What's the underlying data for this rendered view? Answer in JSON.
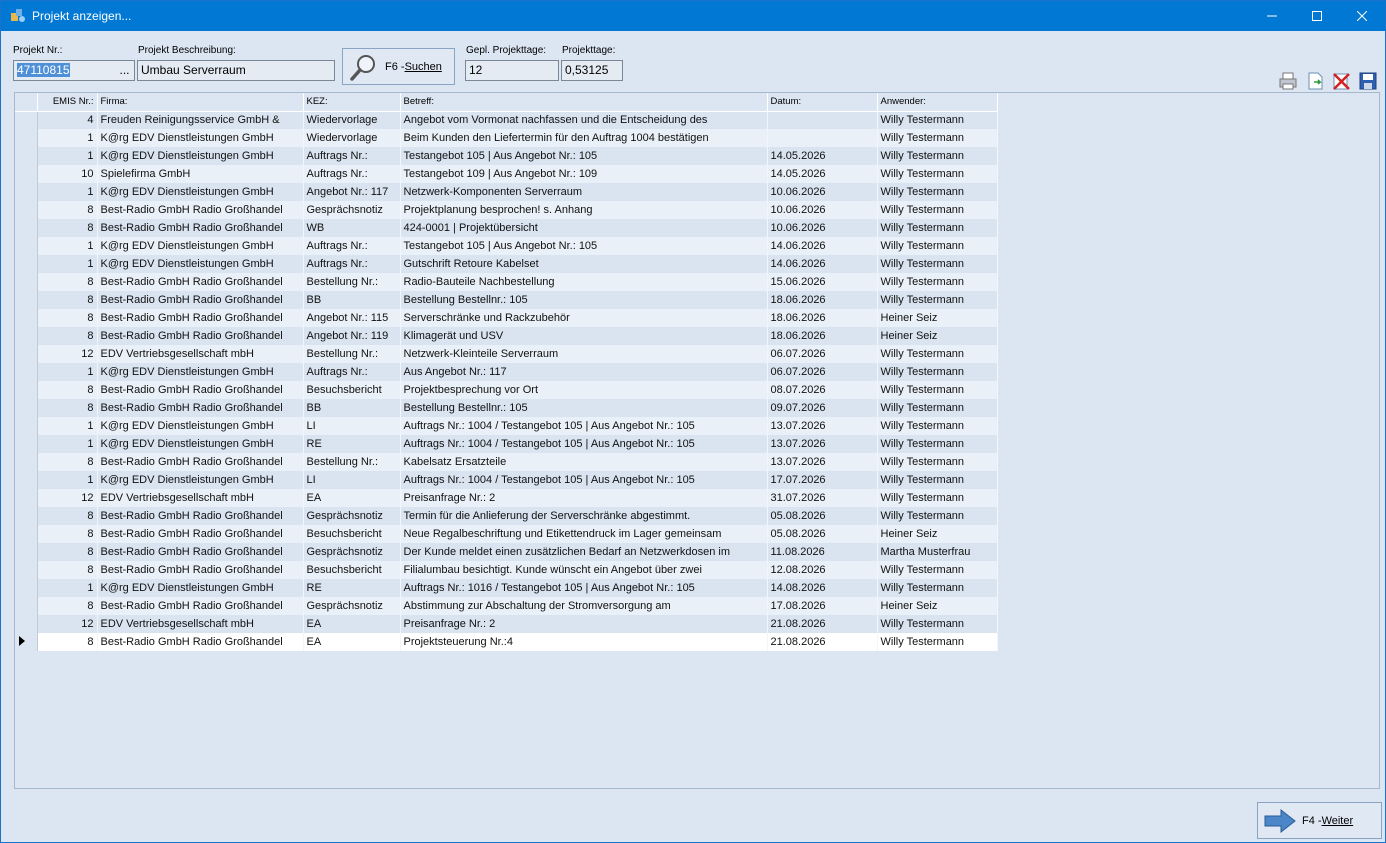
{
  "window": {
    "title": "Projekt anzeigen..."
  },
  "form": {
    "projekt_nr_label": "Projekt Nr.:",
    "projekt_nr_value": "47110815",
    "browse_label": "...",
    "beschreibung_label": "Projekt Beschreibung:",
    "beschreibung_value": "Umbau Serverraum",
    "search_button_key": "F6 - ",
    "search_button_label": "Suchen",
    "gepl_label": "Gepl. Projekttage:",
    "gepl_value": "12",
    "tage_label": "Projekttage:",
    "tage_value": "0,53125"
  },
  "toolbar": {
    "icons": [
      "print-icon",
      "export-icon",
      "delete-icon",
      "save-icon"
    ]
  },
  "table": {
    "columns": [
      "EMIS Nr.:",
      "Firma:",
      "KEZ:",
      "Betreff:",
      "Datum:",
      "Anwender:"
    ],
    "active_row_index": 29,
    "rows": [
      [
        "4",
        "Freuden Reinigungsservice GmbH &",
        "Wiedervorlage",
        "Angebot vom Vormonat nachfassen und die Entscheidung des",
        "",
        "Willy Testermann"
      ],
      [
        "1",
        "K@rg EDV Dienstleistungen GmbH",
        "Wiedervorlage",
        "Beim Kunden den Liefertermin für den Auftrag 1004 bestätigen",
        "",
        "Willy Testermann"
      ],
      [
        "1",
        "K@rg EDV Dienstleistungen GmbH",
        "Auftrags Nr.:",
        "Testangebot 105 | Aus Angebot Nr.: 105",
        "14.05.2026",
        "Willy Testermann"
      ],
      [
        "10",
        "Spielefirma GmbH",
        "Auftrags Nr.:",
        "Testangebot 109 | Aus Angebot Nr.: 109",
        "14.05.2026",
        "Willy Testermann"
      ],
      [
        "1",
        "K@rg EDV Dienstleistungen GmbH",
        "Angebot Nr.: 117",
        "Netzwerk-Komponenten Serverraum",
        "10.06.2026",
        "Willy Testermann"
      ],
      [
        "8",
        "Best-Radio GmbH Radio Großhandel",
        "Gesprächsnotiz",
        "Projektplanung besprochen! s. Anhang",
        "10.06.2026",
        "Willy Testermann"
      ],
      [
        "8",
        "Best-Radio GmbH Radio Großhandel",
        "WB",
        "424-0001 | Projektübersicht",
        "10.06.2026",
        "Willy Testermann"
      ],
      [
        "1",
        "K@rg EDV Dienstleistungen GmbH",
        "Auftrags Nr.:",
        "Testangebot 105 | Aus Angebot Nr.: 105",
        "14.06.2026",
        "Willy Testermann"
      ],
      [
        "1",
        "K@rg EDV Dienstleistungen GmbH",
        "Auftrags Nr.:",
        "Gutschrift Retoure Kabelset",
        "14.06.2026",
        "Willy Testermann"
      ],
      [
        "8",
        "Best-Radio GmbH Radio Großhandel",
        "Bestellung Nr.:",
        "Radio-Bauteile Nachbestellung",
        "15.06.2026",
        "Willy Testermann"
      ],
      [
        "8",
        "Best-Radio GmbH Radio Großhandel",
        "BB",
        "Bestellung Bestellnr.: 105",
        "18.06.2026",
        "Willy Testermann"
      ],
      [
        "8",
        "Best-Radio GmbH Radio Großhandel",
        "Angebot Nr.: 115",
        "Serverschränke und Rackzubehör",
        "18.06.2026",
        "Heiner Seiz"
      ],
      [
        "8",
        "Best-Radio GmbH Radio Großhandel",
        "Angebot Nr.: 119",
        "Klimagerät und USV",
        "18.06.2026",
        "Heiner Seiz"
      ],
      [
        "12",
        "EDV Vertriebsgesellschaft mbH",
        "Bestellung Nr.:",
        "Netzwerk-Kleinteile Serverraum",
        "06.07.2026",
        "Willy Testermann"
      ],
      [
        "1",
        "K@rg EDV Dienstleistungen GmbH",
        "Auftrags Nr.:",
        "Aus Angebot Nr.: 117",
        "06.07.2026",
        "Willy Testermann"
      ],
      [
        "8",
        "Best-Radio GmbH Radio Großhandel",
        "Besuchsbericht",
        "Projektbesprechung vor Ort",
        "08.07.2026",
        "Willy Testermann"
      ],
      [
        "8",
        "Best-Radio GmbH Radio Großhandel",
        "BB",
        "Bestellung Bestellnr.: 105",
        "09.07.2026",
        "Willy Testermann"
      ],
      [
        "1",
        "K@rg EDV Dienstleistungen GmbH",
        "LI",
        "Auftrags Nr.: 1004 / Testangebot 105 | Aus Angebot Nr.: 105",
        "13.07.2026",
        "Willy Testermann"
      ],
      [
        "1",
        "K@rg EDV Dienstleistungen GmbH",
        "RE",
        "Auftrags Nr.: 1004 / Testangebot 105 | Aus Angebot Nr.: 105",
        "13.07.2026",
        "Willy Testermann"
      ],
      [
        "8",
        "Best-Radio GmbH Radio Großhandel",
        "Bestellung Nr.:",
        "Kabelsatz Ersatzteile",
        "13.07.2026",
        "Willy Testermann"
      ],
      [
        "1",
        "K@rg EDV Dienstleistungen GmbH",
        "LI",
        "Auftrags Nr.: 1004 / Testangebot 105 | Aus Angebot Nr.: 105",
        "17.07.2026",
        "Willy Testermann"
      ],
      [
        "12",
        "EDV Vertriebsgesellschaft mbH",
        "EA",
        "Preisanfrage Nr.: 2",
        "31.07.2026",
        "Willy Testermann"
      ],
      [
        "8",
        "Best-Radio GmbH Radio Großhandel",
        "Gesprächsnotiz",
        "Termin für die Anlieferung der Serverschränke abgestimmt.",
        "05.08.2026",
        "Willy Testermann"
      ],
      [
        "8",
        "Best-Radio GmbH Radio Großhandel",
        "Besuchsbericht",
        "Neue Regalbeschriftung und Etikettendruck im Lager gemeinsam",
        "05.08.2026",
        "Heiner Seiz"
      ],
      [
        "8",
        "Best-Radio GmbH Radio Großhandel",
        "Gesprächsnotiz",
        "Der Kunde meldet einen zusätzlichen Bedarf an Netzwerkdosen im",
        "11.08.2026",
        "Martha Musterfrau"
      ],
      [
        "8",
        "Best-Radio GmbH Radio Großhandel",
        "Besuchsbericht",
        "Filialumbau besichtigt. Kunde wünscht ein Angebot über zwei",
        "12.08.2026",
        "Willy Testermann"
      ],
      [
        "1",
        "K@rg EDV Dienstleistungen GmbH",
        "RE",
        "Auftrags Nr.: 1016 / Testangebot 105 | Aus Angebot Nr.: 105",
        "14.08.2026",
        "Willy Testermann"
      ],
      [
        "8",
        "Best-Radio GmbH Radio Großhandel",
        "Gesprächsnotiz",
        "Abstimmung zur Abschaltung der Stromversorgung am",
        "17.08.2026",
        "Heiner Seiz"
      ],
      [
        "12",
        "EDV Vertriebsgesellschaft mbH",
        "EA",
        "Preisanfrage Nr.: 2",
        "21.08.2026",
        "Willy Testermann"
      ],
      [
        "8",
        "Best-Radio GmbH Radio Großhandel",
        "EA",
        "Projektsteuerung Nr.:4",
        "21.08.2026",
        "Willy Testermann"
      ]
    ]
  },
  "footer": {
    "weiter_key": "F4 - ",
    "weiter_label": "Weiter"
  },
  "colors": {
    "titlebar": "#0078d4",
    "background": "#dce6f2",
    "selection": "#4f8fd8"
  }
}
